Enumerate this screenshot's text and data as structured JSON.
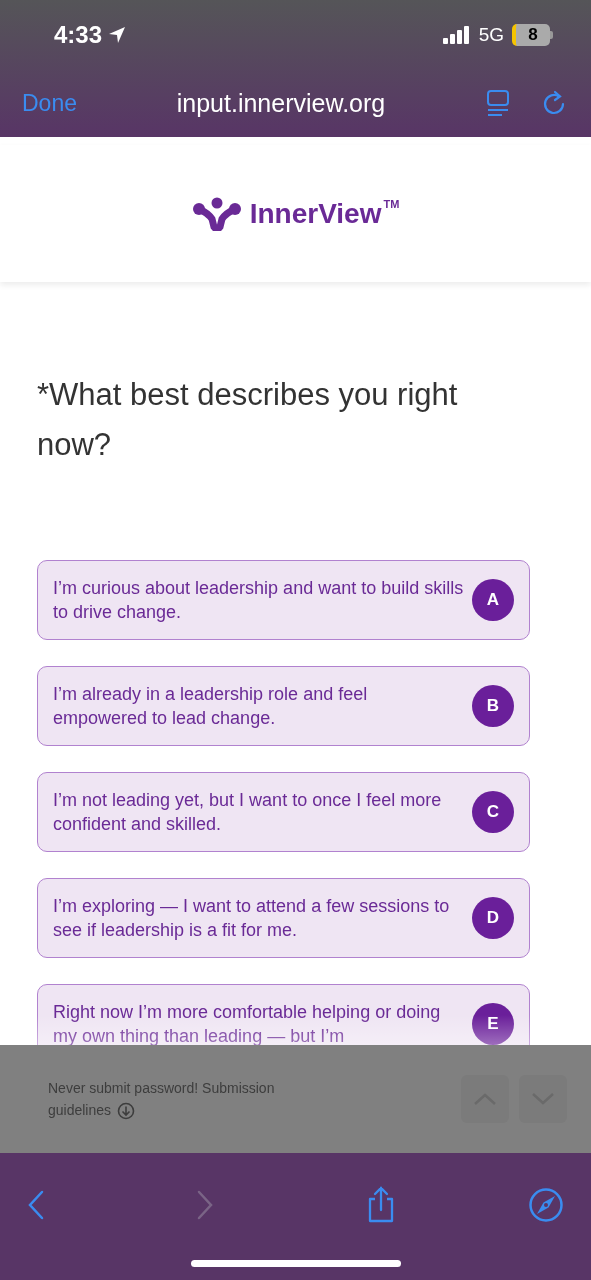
{
  "status_bar": {
    "time": "4:33",
    "network": "5G",
    "battery": "8"
  },
  "browser_bar": {
    "done": "Done",
    "url": "input.innerview.org"
  },
  "header": {
    "logo": "InnerView",
    "trademark": "TM"
  },
  "question": "*What best describes you right now?",
  "options": [
    {
      "text": "I’m curious about leadership and want to build skills to drive change.",
      "letter": "A"
    },
    {
      "text": "I’m already in a leadership role and feel empowered to lead change.",
      "letter": "B"
    },
    {
      "text": "I’m not leading yet, but I want to once I feel more confident and skilled.",
      "letter": "C"
    },
    {
      "text": "I’m exploring — I want to attend a few sessions to see if leadership is a fit for me.",
      "letter": "D"
    },
    {
      "text": "Right now I’m more comfortable helping or doing my own thing than leading — but I’m",
      "letter": "E"
    }
  ],
  "footer": {
    "notice": "Never submit password! Submission guidelines",
    "up_disabled": true,
    "down_disabled": true
  },
  "toolbar": {
    "back_disabled": false,
    "forward_disabled": true
  }
}
